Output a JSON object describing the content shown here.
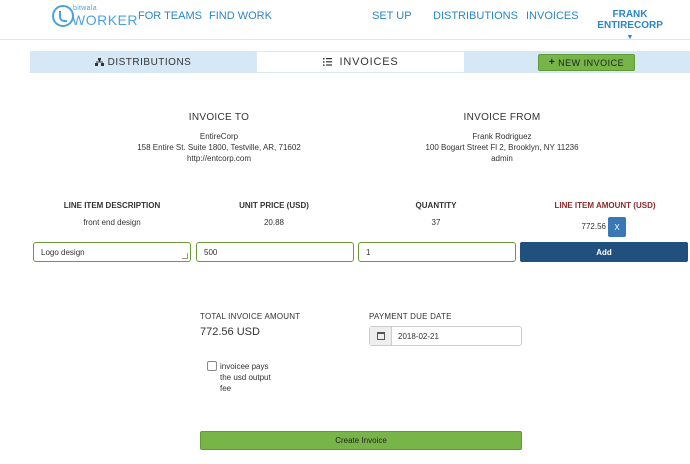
{
  "brand": {
    "top": "bitwala",
    "bottom": "WORKER"
  },
  "nav": {
    "for_teams": "FOR TEAMS",
    "find_work": "FIND WORK",
    "set_up": "SET UP",
    "distributions": "DISTRIBUTIONS",
    "invoices": "INVOICES",
    "user_line1": "FRANK",
    "user_line2": "ENTIRECORP"
  },
  "tabs": {
    "distributions": "DISTRIBUTIONS",
    "invoices": "INVOICES",
    "new_invoice": "NEW INVOICE"
  },
  "invoice_to": {
    "heading": "INVOICE TO",
    "name": "EntireCorp",
    "address": "158 Entire St. Suite 1800, Testville, AR, 71602",
    "url": "http://entcorp.com"
  },
  "invoice_from": {
    "heading": "INVOICE FROM",
    "name": "Frank Rodriguez",
    "address": "100 Bogart Street Fl 2, Brooklyn, NY 11236",
    "role": "admin"
  },
  "line_items": {
    "headers": {
      "description": "LINE ITEM DESCRIPTION",
      "unit_price": "UNIT PRICE (USD)",
      "quantity": "QUANTITY",
      "amount": "LINE ITEM AMOUNT (USD)"
    },
    "rows": [
      {
        "description": "front end design",
        "unit_price": "20.88",
        "quantity": "37",
        "amount": "772.56",
        "remove_label": "X"
      }
    ],
    "new_row": {
      "description": "Logo design",
      "unit_price": "500",
      "quantity": "1",
      "add_label": "Add"
    }
  },
  "totals": {
    "label": "TOTAL INVOICE AMOUNT",
    "value": "772.56 USD",
    "due_label": "PAYMENT DUE DATE",
    "due_date": "2018-02-21"
  },
  "fee_checkbox": {
    "label": "invoicee pays the usd output fee",
    "checked": false
  },
  "create_label": "Create Invoice",
  "colors": {
    "link": "#2a86c6",
    "tab_bg": "#d6e8f6",
    "green": "#78b548",
    "navy": "#21507f",
    "x_button": "#3a78b5"
  },
  "icons": [
    "hierarchy-icon",
    "list-icon",
    "plus-icon",
    "calendar-icon",
    "chevron-down-icon"
  ]
}
